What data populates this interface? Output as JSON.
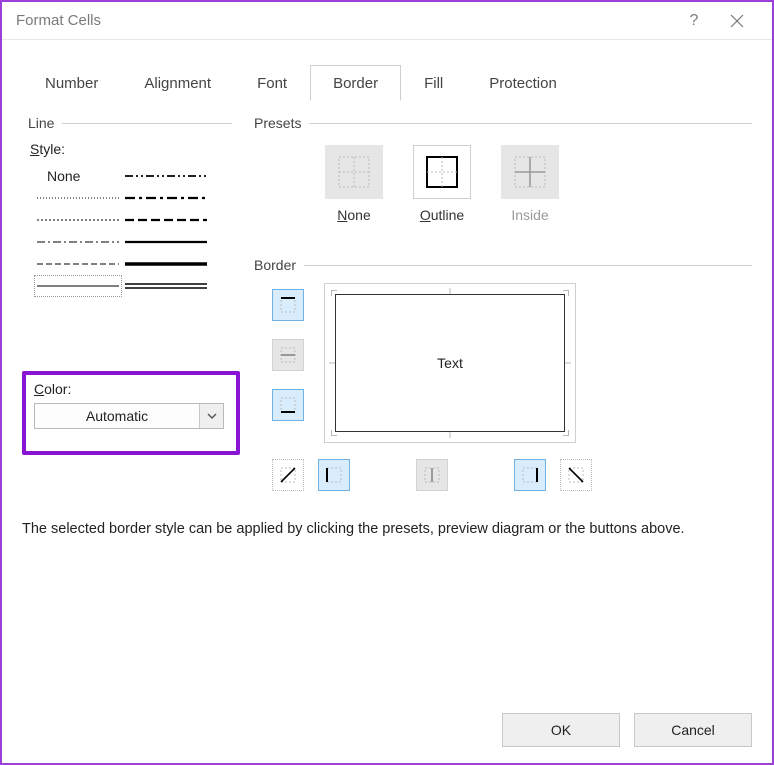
{
  "window": {
    "title": "Format Cells"
  },
  "tabs": [
    "Number",
    "Alignment",
    "Font",
    "Border",
    "Fill",
    "Protection"
  ],
  "active_tab": "Border",
  "line": {
    "group": "Line",
    "style_label": "Style:",
    "none": "None"
  },
  "color": {
    "label": "Color:",
    "value": "Automatic"
  },
  "presets": {
    "group": "Presets",
    "none": "None",
    "outline": "Outline",
    "inside": "Inside"
  },
  "border": {
    "group": "Border",
    "preview_text": "Text"
  },
  "instruction": "The selected border style can be applied by clicking the presets, preview diagram or the buttons above.",
  "buttons": {
    "ok": "OK",
    "cancel": "Cancel"
  }
}
